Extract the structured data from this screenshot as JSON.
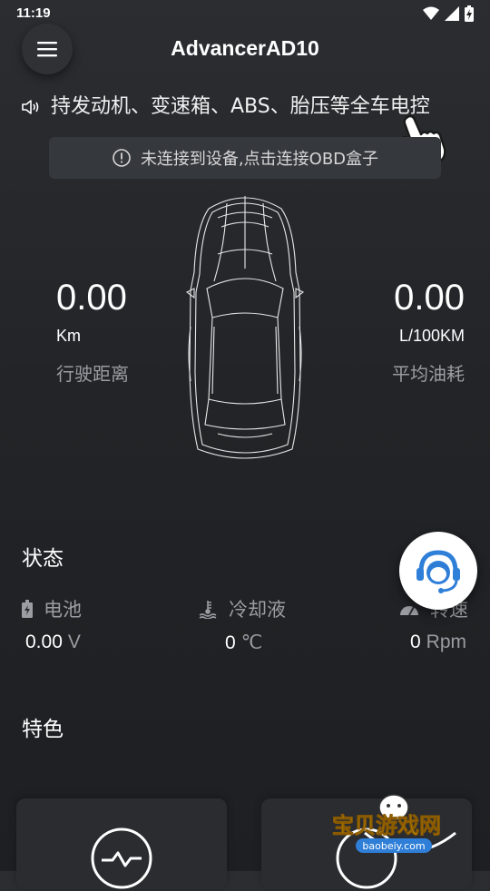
{
  "status_bar": {
    "time": "11:19"
  },
  "header": {
    "title": "AdvancerAD10"
  },
  "marquee": {
    "text": "持发动机、变速箱、ABS、胎压等全车电控"
  },
  "connect_bar": {
    "text": "未连接到设备,点击连接OBD盒子"
  },
  "stats": {
    "distance": {
      "value": "0.00",
      "unit": "Km",
      "label": "行驶距离"
    },
    "fuel": {
      "value": "0.00",
      "unit": "L/100KM",
      "label": "平均油耗"
    }
  },
  "state": {
    "title": "状态",
    "battery": {
      "label": "电池",
      "value": "0.00",
      "unit": "V"
    },
    "coolant": {
      "label": "冷却液",
      "value": "0",
      "unit": "℃"
    },
    "rpm": {
      "label": "转速",
      "value": "0",
      "unit": "Rpm"
    }
  },
  "features": {
    "title": "特色"
  },
  "watermark": {
    "text": "宝贝游戏网",
    "url": "baobeiy.com"
  },
  "colors": {
    "background": "#222427",
    "card": "#2a2c30",
    "accent_blue": "#2f7fd8",
    "muted_text": "#9a9da2"
  }
}
